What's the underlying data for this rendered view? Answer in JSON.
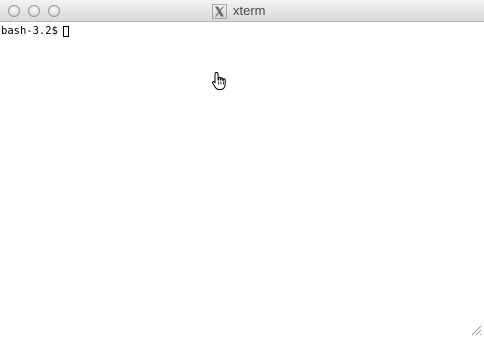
{
  "window": {
    "title": "xterm",
    "app_icon": "x-window-system-icon"
  },
  "titlebar": {
    "buttons": [
      "close",
      "minimize",
      "zoom"
    ]
  },
  "terminal": {
    "prompt": "bash-3.2$",
    "input": ""
  },
  "pointer": {
    "icon": "hand-pointer-icon"
  },
  "colors": {
    "terminal_background": "#ffffff",
    "terminal_text": "#000000",
    "titlebar": "#e6e6e6"
  }
}
